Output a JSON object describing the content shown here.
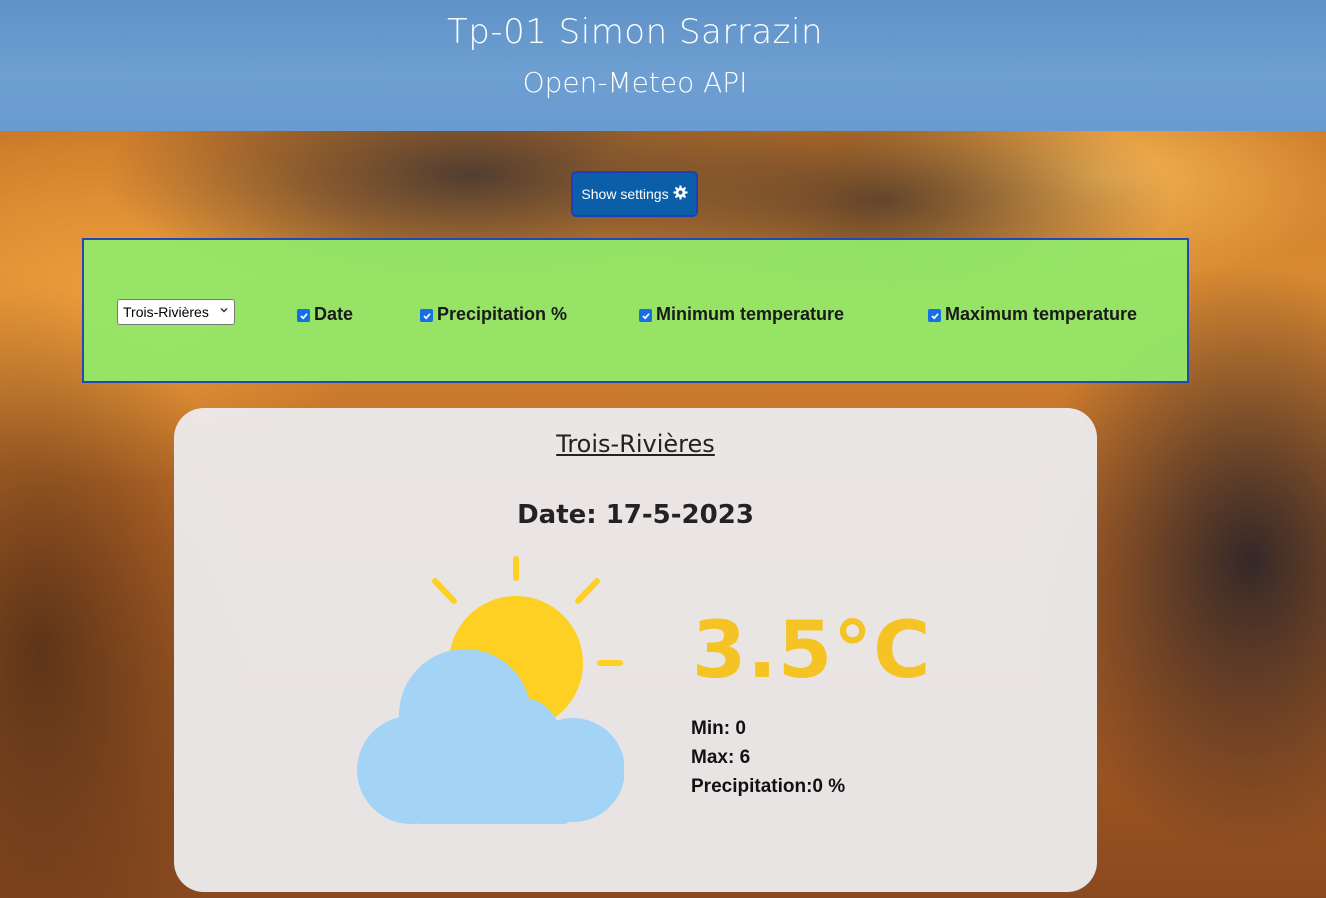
{
  "header": {
    "title": "Tp-01 Simon Sarrazin",
    "subtitle": "Open-Meteo API"
  },
  "settings_button": {
    "label": "Show settings",
    "icon": "gear-icon"
  },
  "settings": {
    "city_select": {
      "selected": "Trois-Rivières"
    },
    "options": [
      {
        "label": "Date",
        "checked": true
      },
      {
        "label": "Precipitation %",
        "checked": true
      },
      {
        "label": "Minimum temperature",
        "checked": true
      },
      {
        "label": "Maximum temperature",
        "checked": true
      }
    ]
  },
  "weather": {
    "city": "Trois-Rivières",
    "date_line": "Date: 17-5-2023",
    "icon": "partly-cloudy-icon",
    "temperature": "3.5°C",
    "min": "Min: 0",
    "max": "Max: 6",
    "precipitation": "Precipitation:0 %"
  },
  "colors": {
    "header_bg": "#6a9bd0",
    "button_bg": "#0a5fa8",
    "panel_bg": "#92e868",
    "temperature": "#f5c324",
    "sun": "#fdd023",
    "cloud": "#a3d3f5"
  }
}
